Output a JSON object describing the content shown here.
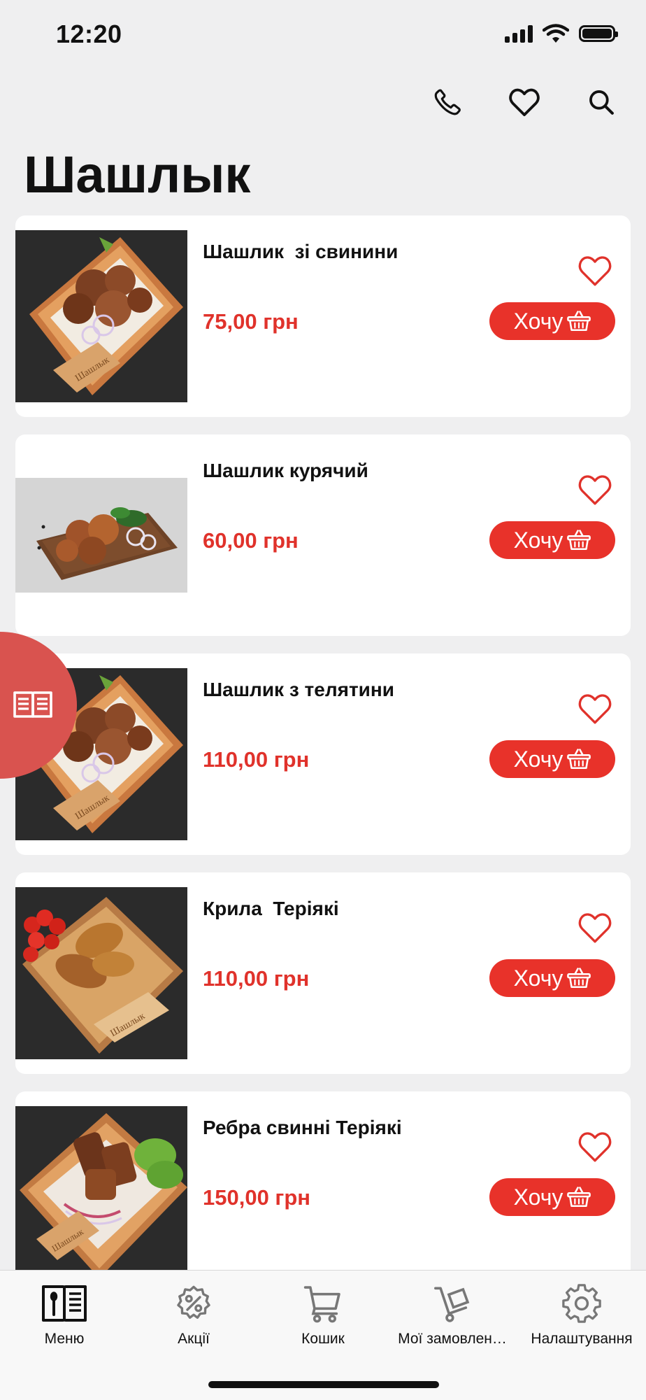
{
  "status_bar": {
    "time": "12:20"
  },
  "header": {
    "title": "Шашлык",
    "actions": [
      "phone-icon",
      "heart-icon",
      "search-icon"
    ]
  },
  "products": [
    {
      "name": "Шашлик  зі свинини",
      "price": "75,00 грн",
      "button": "Хочу"
    },
    {
      "name": "Шашлик курячий",
      "price": "60,00 грн",
      "button": "Хочу"
    },
    {
      "name": "Шашлик з телятини",
      "price": "110,00 грн",
      "button": "Хочу"
    },
    {
      "name": "Крила  Теріякі",
      "price": "110,00 грн",
      "button": "Хочу"
    },
    {
      "name": "Ребра свинні Теріякі",
      "price": "150,00 грн",
      "button": "Хочу"
    }
  ],
  "tabs": [
    {
      "label": "Меню",
      "icon": "menu-book-icon",
      "active": true
    },
    {
      "label": "Акції",
      "icon": "discount-icon",
      "active": false
    },
    {
      "label": "Кошик",
      "icon": "cart-icon",
      "active": false
    },
    {
      "label": "Мої замовлен…",
      "icon": "orders-icon",
      "active": false
    },
    {
      "label": "Налаштування",
      "icon": "gear-icon",
      "active": false
    }
  ],
  "colors": {
    "accent": "#e8322a",
    "price": "#e0322b",
    "fab": "#d9534f",
    "background": "#efeff0",
    "card": "#ffffff"
  }
}
